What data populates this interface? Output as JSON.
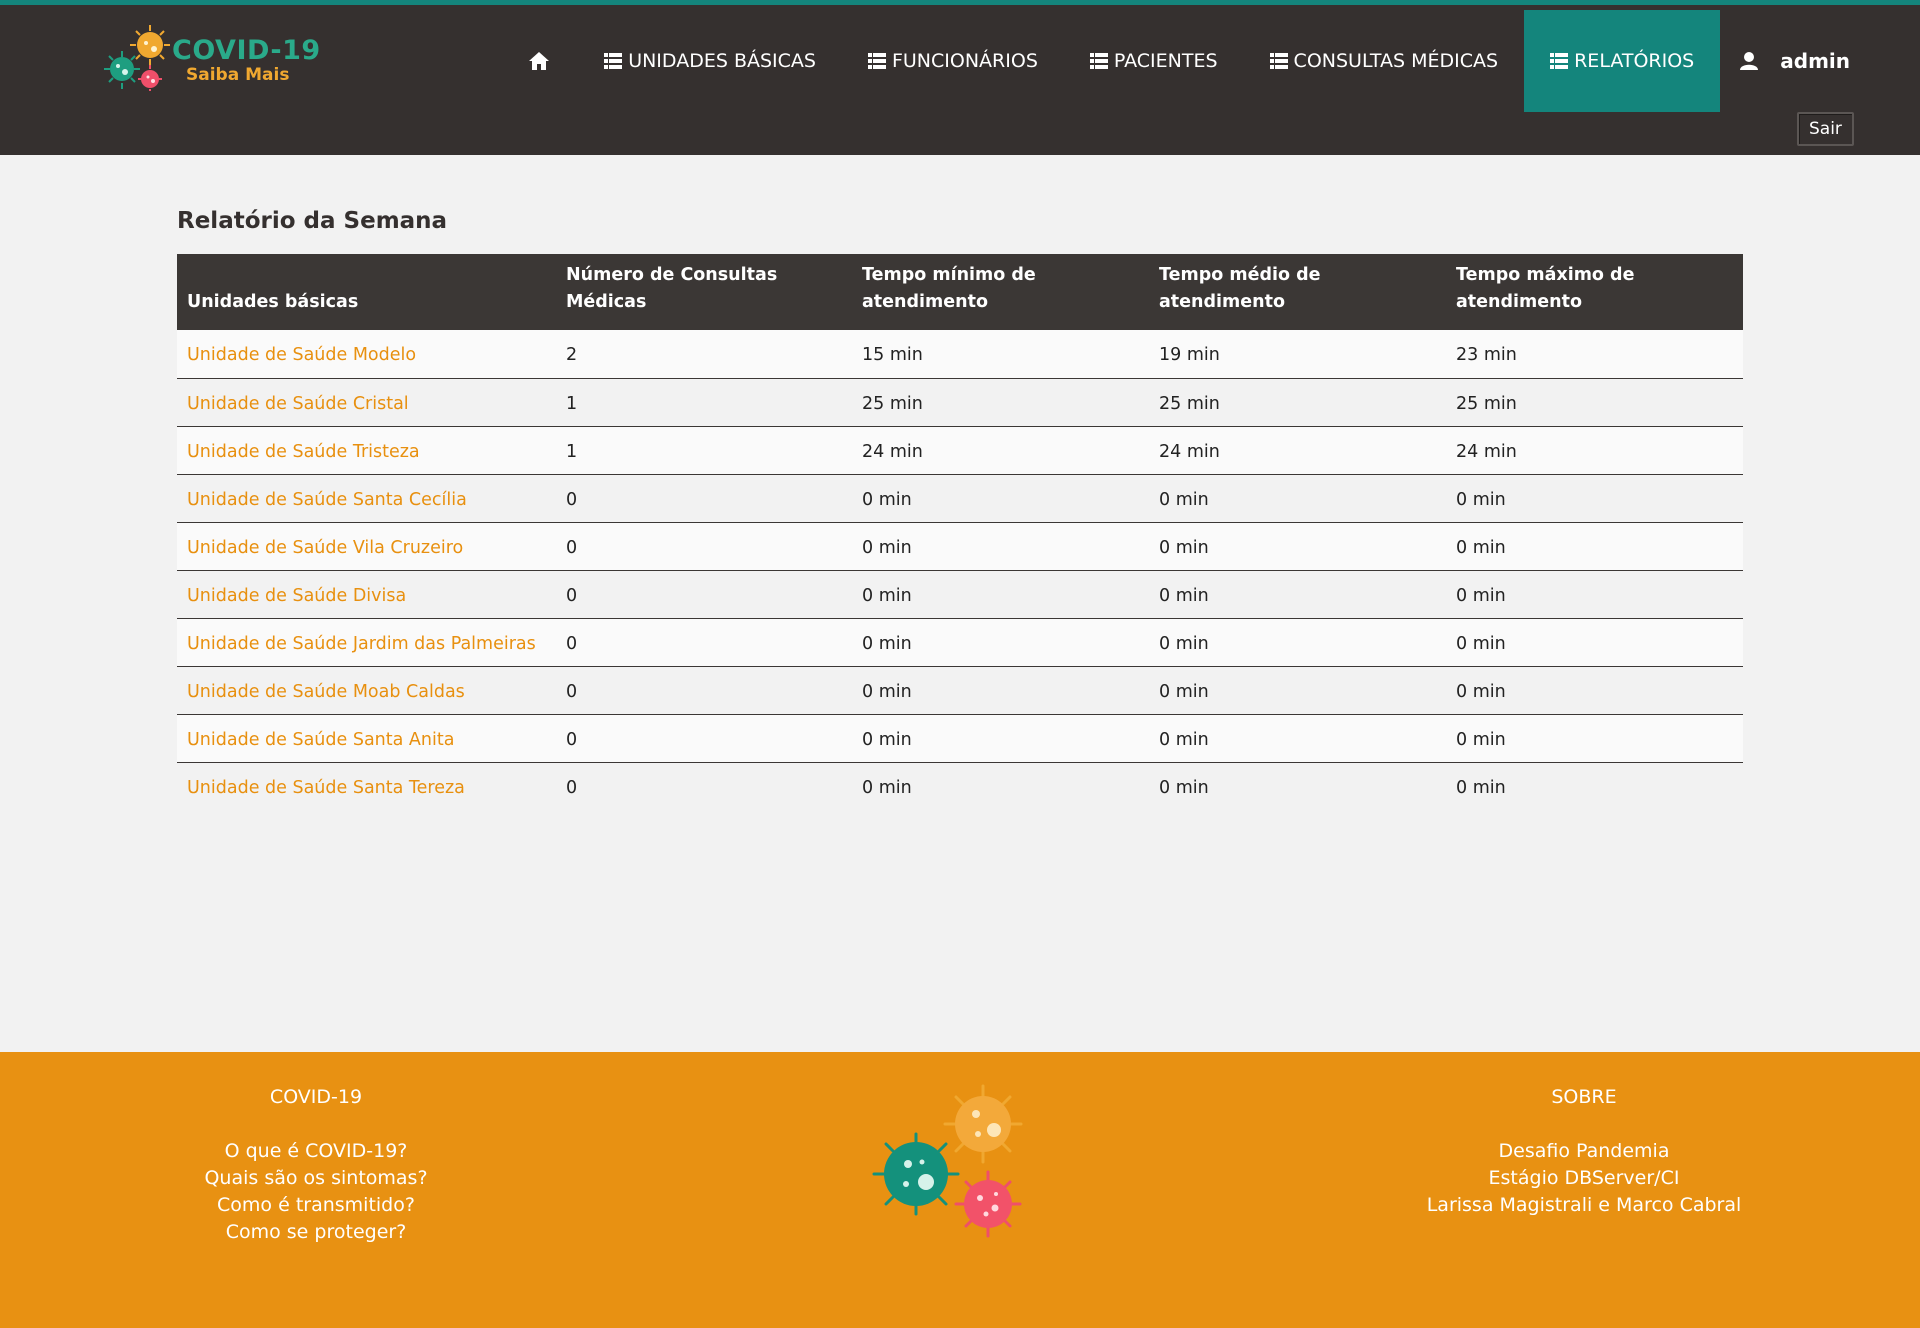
{
  "brand": {
    "title": "COVID-19",
    "subtitle": "Saiba Mais"
  },
  "nav": {
    "items": [
      {
        "label": "UNIDADES BÁSICAS",
        "icon": "list-icon"
      },
      {
        "label": "FUNCIONÁRIOS",
        "icon": "list-icon"
      },
      {
        "label": "PACIENTES",
        "icon": "list-icon"
      },
      {
        "label": "CONSULTAS MÉDICAS",
        "icon": "list-icon"
      },
      {
        "label": "RELATÓRIOS",
        "icon": "list-icon",
        "active": true
      }
    ],
    "home_icon": "home-icon",
    "user": "admin",
    "user_icon": "user-icon",
    "logout_label": "Sair"
  },
  "report": {
    "title": "Relatório da Semana",
    "columns": [
      "Unidades básicas",
      "Número de Consultas Médicas",
      "Tempo mínimo de atendimento",
      "Tempo médio de atendimento",
      "Tempo máximo de atendimento"
    ],
    "rows": [
      {
        "unit": "Unidade de Saúde Modelo",
        "count": "2",
        "min": "15 min",
        "avg": "19 min",
        "max": "23 min"
      },
      {
        "unit": "Unidade de Saúde Cristal",
        "count": "1",
        "min": "25 min",
        "avg": "25 min",
        "max": "25 min"
      },
      {
        "unit": "Unidade de Saúde Tristeza",
        "count": "1",
        "min": "24 min",
        "avg": "24 min",
        "max": "24 min"
      },
      {
        "unit": "Unidade de Saúde Santa Cecília",
        "count": "0",
        "min": "0 min",
        "avg": "0 min",
        "max": "0 min"
      },
      {
        "unit": "Unidade de Saúde Vila Cruzeiro",
        "count": "0",
        "min": "0 min",
        "avg": "0 min",
        "max": "0 min"
      },
      {
        "unit": "Unidade de Saúde Divisa",
        "count": "0",
        "min": "0 min",
        "avg": "0 min",
        "max": "0 min"
      },
      {
        "unit": "Unidade de Saúde Jardim das Palmeiras",
        "count": "0",
        "min": "0 min",
        "avg": "0 min",
        "max": "0 min"
      },
      {
        "unit": "Unidade de Saúde Moab Caldas",
        "count": "0",
        "min": "0 min",
        "avg": "0 min",
        "max": "0 min"
      },
      {
        "unit": "Unidade de Saúde Santa Anita",
        "count": "0",
        "min": "0 min",
        "avg": "0 min",
        "max": "0 min"
      },
      {
        "unit": "Unidade de Saúde Santa Tereza",
        "count": "0",
        "min": "0 min",
        "avg": "0 min",
        "max": "0 min"
      }
    ]
  },
  "footer": {
    "left": {
      "heading": "COVID-19",
      "links": [
        "O que é COVID-19?",
        "Quais são os sintomas?",
        "Como é transmitido?",
        "Como se proteger?"
      ]
    },
    "right": {
      "heading": "SOBRE",
      "lines": [
        "Desafio Pandemia",
        "Estágio DBServer/CI",
        "Larissa Magistrali e Marco Cabral"
      ]
    }
  },
  "colors": {
    "header_bg": "#35302f",
    "accent_teal": "#14857c",
    "link_orange": "#e8900f",
    "footer_orange": "#e89112"
  }
}
